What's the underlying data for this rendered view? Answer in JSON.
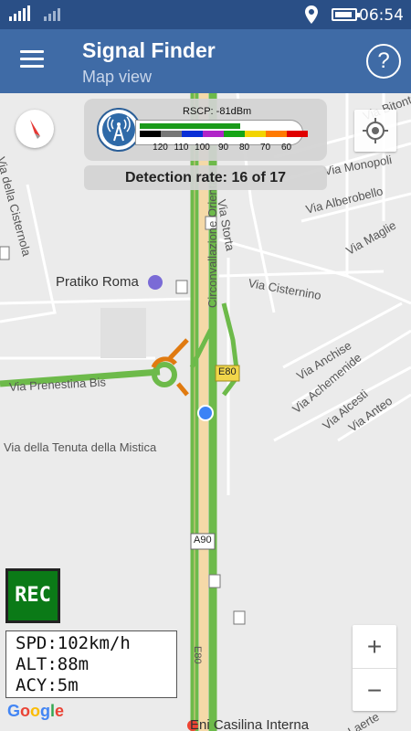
{
  "status_bar": {
    "time": "06:54",
    "signal_icons": [
      "signal-strength-icon",
      "signal-strength-icon"
    ],
    "location_icon": "location-pin-icon",
    "battery_icon": "battery-icon"
  },
  "app_bar": {
    "title": "Signal Finder",
    "subtitle": "Map view",
    "menu_icon": "hamburger-menu-icon",
    "help_label": "?"
  },
  "signal_panel": {
    "rscp": "RSCP: -81dBm",
    "rscp_value_dbm": -81,
    "scale_colors": [
      "#000000",
      "#777777",
      "#0a2fd6",
      "#b025c8",
      "#16a516",
      "#f2d400",
      "#ff7a00",
      "#e00000"
    ],
    "scale_ticks": [
      "120",
      "110",
      "100",
      "90",
      "80",
      "70",
      "60"
    ],
    "fill_fraction": 0.6
  },
  "detection": {
    "text": "Detection rate: 16 of 17"
  },
  "map_labels": {
    "via_della_cisternola": "Via della Cisternola",
    "via_monopoli": "Via Monopoli",
    "via_alberobello": "Via Alberobello",
    "via_maglie": "Via Maglie",
    "via_storta": "Via Storta",
    "via_cisternino": "Via Cisternino",
    "via_bitonto": "Via Bitonto",
    "pratiko_roma": "Pratiko Roma",
    "via_prenestina_bis": "Via Prenestina Bis",
    "circonvallazione_orientale": "Circonvallazione Orientale",
    "e80_top": "E80",
    "via_anchise": "Via Anchise",
    "via_achemenide": "Via Achemenide",
    "via_alcesti": "Via Alcesti",
    "via_anteo": "Via Anteo",
    "via_tenuta_mistica": "Via della Tenuta della Mistica",
    "a90": "A90",
    "e80_bottom": "E80",
    "eni_casilina": "Eni Casilina Interna",
    "laerte": "Laerte"
  },
  "controls": {
    "rec": "REC",
    "zoom_in": "+",
    "zoom_out": "−"
  },
  "telemetry": {
    "spd_label": "SPD:",
    "spd_value": "102km/h",
    "alt_label": "ALT:",
    "alt_value": "88m",
    "acy_label": "ACY:",
    "acy_value": "5m"
  },
  "google_logo": "Google"
}
